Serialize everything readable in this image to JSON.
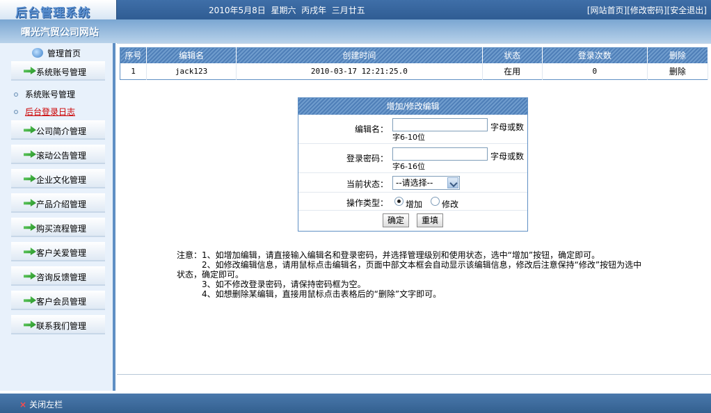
{
  "header": {
    "logo": "后台管理系统",
    "date_text": "2010年5月8日  星期六  丙戌年  三月廿五",
    "links": [
      "[网站首页]",
      "[修改密码]",
      "[安全退出]"
    ]
  },
  "site": {
    "name": "曙光汽贸公司网站"
  },
  "sidebar": {
    "home": "管理首页",
    "menu": [
      "系统账号管理",
      "公司简介管理",
      "滚动公告管理",
      "企业文化管理",
      "产品介绍管理",
      "购买流程管理",
      "客户关爱管理",
      "咨询反馈管理",
      "客户会员管理",
      "联系我们管理"
    ],
    "submenu": [
      "系统账号管理",
      "后台登录日志"
    ],
    "active_sub": "后台登录日志"
  },
  "table": {
    "headers": [
      "序号",
      "编辑名",
      "创建时间",
      "状态",
      "登录次数",
      "删除"
    ],
    "rows": [
      [
        "1",
        "jack123",
        "2010-03-17 12:21:25.0",
        "在用",
        "0",
        "删除"
      ]
    ]
  },
  "form": {
    "title": "增加/修改编辑",
    "name_label": "编辑名：",
    "name_hint_a": "字母或数",
    "name_hint_b": "字6-10位",
    "pwd_label": "登录密码：",
    "pwd_hint_a": "字母或数",
    "pwd_hint_b": "字6-16位",
    "status_label": "当前状态：",
    "status_selected": "--请选择--",
    "op_label": "操作类型：",
    "op_add": "增加",
    "op_edit": "修改",
    "submit": "确定",
    "reset": "重填"
  },
  "notes": {
    "l1": "注意：1、如增加编辑，请直接输入编辑名和登录密码，并选择管理级别和使用状态，选中“增加”按钮，确定即可。",
    "l2": "2、如修改编辑信息，请用鼠标点击编辑名，页面中部文本框会自动显示该编辑信息，修改后注意保持“修改”按钮为选中",
    "l3": "状态，确定即可。",
    "l4": "3、如不修改登录密码，请保持密码框为空。",
    "l5": "4、如想删除某编辑，直接用鼠标点击表格后的“删除”文字即可。"
  },
  "footer": {
    "close_left": "关闭左栏"
  },
  "colors": {
    "header_blue": "#2f5c93",
    "panel_border": "#5f8fc4",
    "active_red": "#cc0000"
  }
}
